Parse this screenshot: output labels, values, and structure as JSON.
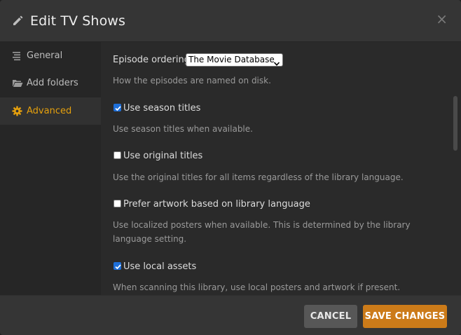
{
  "dialog": {
    "title": "Edit TV Shows",
    "title_icon": "pencil-icon",
    "close_label": "×"
  },
  "sidebar": {
    "items": [
      {
        "label": "General",
        "icon": "list-icon",
        "active": false
      },
      {
        "label": "Add folders",
        "icon": "folder-icon",
        "active": false
      },
      {
        "label": "Advanced",
        "icon": "gear-icon",
        "active": true
      }
    ]
  },
  "advanced": {
    "episode_ordering": {
      "label": "Episode ordering",
      "selected": "The Movie Database",
      "help": "How the episodes are named on disk."
    },
    "options": [
      {
        "label": "Use season titles",
        "checked": true,
        "help": "Use season titles when available."
      },
      {
        "label": "Use original titles",
        "checked": false,
        "help": "Use the original titles for all items regardless of the library language."
      },
      {
        "label": "Prefer artwork based on library language",
        "checked": false,
        "help": "Use localized posters when available. This is determined by the library language setting."
      },
      {
        "label": "Use local assets",
        "checked": true,
        "help": "When scanning this library, use local posters and artwork if present."
      }
    ]
  },
  "footer": {
    "cancel_label": "CANCEL",
    "save_label": "SAVE CHANGES"
  },
  "colors": {
    "accent": "#e5a00d",
    "save_button": "#cc7b19",
    "checkbox": "#1e6fd9"
  }
}
